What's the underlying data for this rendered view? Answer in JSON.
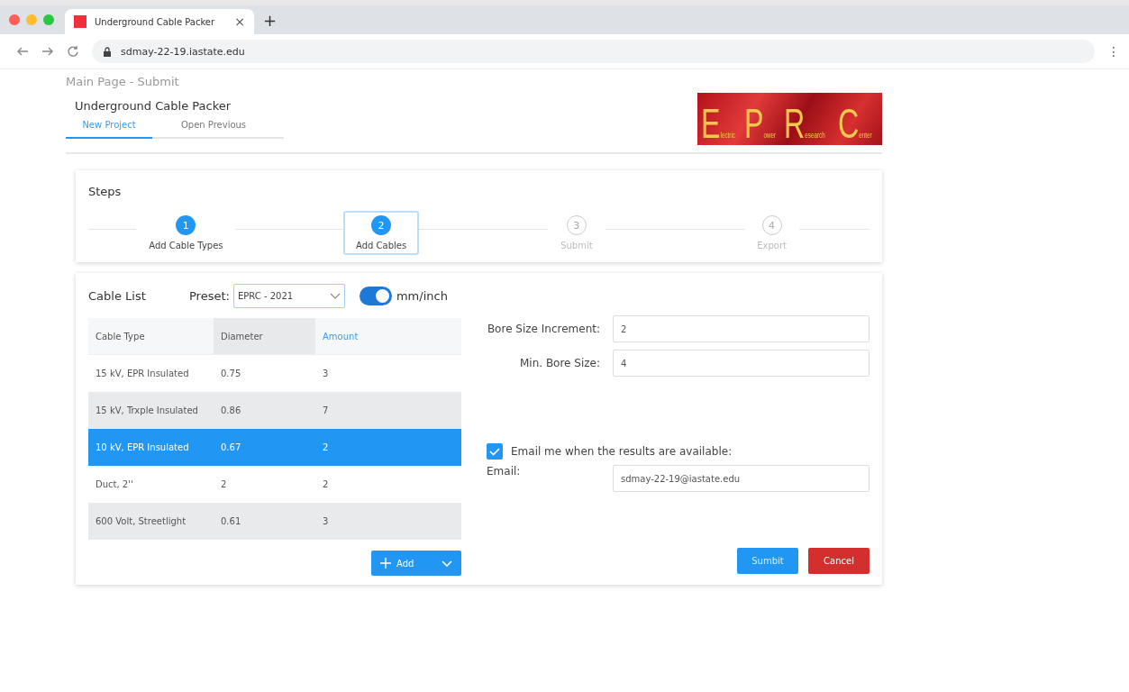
{
  "browser": {
    "tab_title": "Underground Cable Packer",
    "tab_close": "×",
    "new_tab": "+",
    "address": "sdmay-22-19.iastate.edu",
    "menu": "⋮"
  },
  "breadcrumb": "Main Page - Submit",
  "app_title": "Underground Cable Packer",
  "nav_tabs": [
    {
      "label": "New Project",
      "selected": true
    },
    {
      "label": "Open Previous",
      "selected": false
    }
  ],
  "logo": {
    "words": [
      "Electric",
      "Power",
      "Research",
      "Center"
    ]
  },
  "steps": {
    "title": "Steps",
    "items": [
      {
        "number": "1",
        "label": "Add Cable Types",
        "done": true,
        "current": false
      },
      {
        "number": "2",
        "label": "Add Cables",
        "done": true,
        "current": true
      },
      {
        "number": "3",
        "label": "Submit",
        "done": false,
        "current": false
      },
      {
        "number": "4",
        "label": "Export",
        "done": false,
        "current": false
      }
    ]
  },
  "cable_list": {
    "title": "Cable List",
    "preset_label": "Preset:",
    "preset_value": "EPRC - 2021",
    "unit_toggle": {
      "label": "mm/inch",
      "on": true
    },
    "columns": [
      {
        "label": "Cable Type",
        "shaded": false,
        "active": false
      },
      {
        "label": "Diameter",
        "shaded": true,
        "active": false
      },
      {
        "label": "Amount",
        "shaded": false,
        "active": true
      }
    ],
    "rows": [
      {
        "cells": [
          "15 kV, EPR Insulated",
          "0.75",
          "3"
        ],
        "shaded": false,
        "selected": false
      },
      {
        "cells": [
          "15 kV,  Trxple Insulated",
          "0.86",
          "7"
        ],
        "shaded": true,
        "selected": false
      },
      {
        "cells": [
          "10 kV, EPR Insulated",
          "0.67",
          "2"
        ],
        "shaded": false,
        "selected": true
      },
      {
        "cells": [
          "Duct, 2''",
          "2",
          "2"
        ],
        "shaded": false,
        "selected": false
      },
      {
        "cells": [
          "600 Volt, Streetlight",
          "0.61",
          "3"
        ],
        "shaded": true,
        "selected": false
      }
    ],
    "add_button": "Add"
  },
  "settings": {
    "fields": [
      {
        "label": "Bore Size Increment:",
        "value": "2"
      },
      {
        "label": "Min. Bore Size:",
        "value": "4"
      }
    ],
    "email_opt_in": {
      "label": "Email me when the results are available:",
      "checked": true
    },
    "email": {
      "label": "Email:",
      "value": "sdmay-22-19@iastate.edu"
    },
    "buttons": [
      {
        "label": "Sumbit",
        "kind": "primary"
      },
      {
        "label": "Cancel",
        "kind": "danger"
      }
    ]
  }
}
